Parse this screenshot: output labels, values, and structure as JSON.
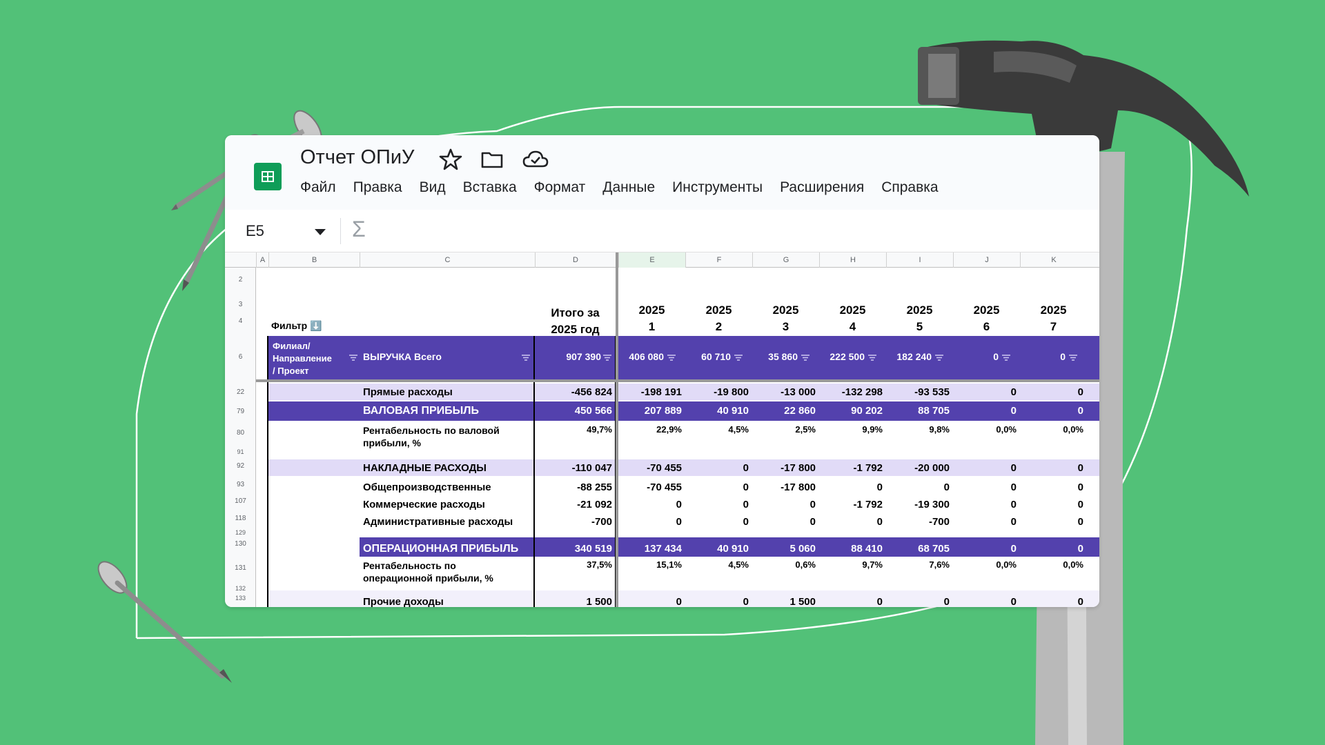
{
  "app": {
    "doc_title": "Отчет ОПиУ",
    "menu": [
      "Файл",
      "Правка",
      "Вид",
      "Вставка",
      "Формат",
      "Данные",
      "Инструменты",
      "Расширения",
      "Справка"
    ],
    "name_box": "E5",
    "formula_symbol": "Σ"
  },
  "icons": [
    "spreadsheet-logo-icon",
    "star-icon",
    "folder-icon",
    "cloud-check-icon",
    "chevron-down-icon",
    "sigma-icon",
    "filter-icon"
  ],
  "colors": {
    "background": "#52c178",
    "band_dark": "#5341ad",
    "band_light": "#e1dbf7",
    "sheets_green": "#0f9d58"
  },
  "sheet": {
    "columns": [
      "A",
      "B",
      "C",
      "D",
      "E",
      "F",
      "G",
      "H",
      "I",
      "J",
      "K"
    ],
    "row_numbers": [
      "2",
      "3",
      "4",
      "6",
      "22",
      "79",
      "80",
      "91",
      "92",
      "93",
      "107",
      "118",
      "129",
      "130",
      "131",
      "132",
      "133"
    ],
    "filter_label": "Фильтр ⬇️",
    "total_header": [
      "Итого за",
      "2025 год"
    ],
    "period_headers": [
      {
        "year": "2025",
        "month": "1"
      },
      {
        "year": "2025",
        "month": "2"
      },
      {
        "year": "2025",
        "month": "3"
      },
      {
        "year": "2025",
        "month": "4"
      },
      {
        "year": "2025",
        "month": "5"
      },
      {
        "year": "2025",
        "month": "6"
      },
      {
        "year": "2025",
        "month": "7"
      }
    ],
    "header_row": {
      "branch_label": [
        "Филиал/",
        "Направление",
        "/ Проект"
      ],
      "metric_label": "ВЫРУЧКА Всего",
      "total": "907 390",
      "values": [
        "406 080",
        "60 710",
        "35 860",
        "222 500",
        "182 240",
        "0",
        "0"
      ]
    },
    "rows": [
      {
        "label": "Прямые расходы",
        "total": "-456 824",
        "values": [
          "-198 191",
          "-19 800",
          "-13 000",
          "-132 298",
          "-93 535",
          "0",
          "0"
        ]
      },
      {
        "label": "ВАЛОВАЯ ПРИБЫЛЬ",
        "total": "450 566",
        "values": [
          "207 889",
          "40 910",
          "22 860",
          "90 202",
          "88 705",
          "0",
          "0"
        ]
      },
      {
        "label": [
          "Рентабельность по валовой",
          "прибыли, %"
        ],
        "total": "49,7%",
        "values": [
          "22,9%",
          "4,5%",
          "2,5%",
          "9,9%",
          "9,8%",
          "0,0%",
          "0,0%"
        ]
      },
      {
        "label": "НАКЛАДНЫЕ РАСХОДЫ",
        "total": "-110 047",
        "values": [
          "-70 455",
          "0",
          "-17 800",
          "-1 792",
          "-20 000",
          "0",
          "0"
        ]
      },
      {
        "label": "Общепроизводственные",
        "total": "-88 255",
        "values": [
          "-70 455",
          "0",
          "-17 800",
          "0",
          "0",
          "0",
          "0"
        ]
      },
      {
        "label": "Коммерческие расходы",
        "total": "-21 092",
        "values": [
          "0",
          "0",
          "0",
          "-1 792",
          "-19 300",
          "0",
          "0"
        ]
      },
      {
        "label": "Административные расходы",
        "total": "-700",
        "values": [
          "0",
          "0",
          "0",
          "0",
          "-700",
          "0",
          "0"
        ]
      },
      {
        "label": "ОПЕРАЦИОННАЯ ПРИБЫЛЬ",
        "total": "340 519",
        "values": [
          "137 434",
          "40 910",
          "5 060",
          "88 410",
          "68 705",
          "0",
          "0"
        ]
      },
      {
        "label": [
          "Рентабельность по",
          "операционной прибыли, %"
        ],
        "total": "37,5%",
        "values": [
          "15,1%",
          "4,5%",
          "0,6%",
          "9,7%",
          "7,6%",
          "0,0%",
          "0,0%"
        ]
      },
      {
        "label": "Прочие доходы",
        "total": "1 500",
        "values": [
          "0",
          "0",
          "1 500",
          "0",
          "0",
          "0",
          "0"
        ]
      }
    ]
  }
}
